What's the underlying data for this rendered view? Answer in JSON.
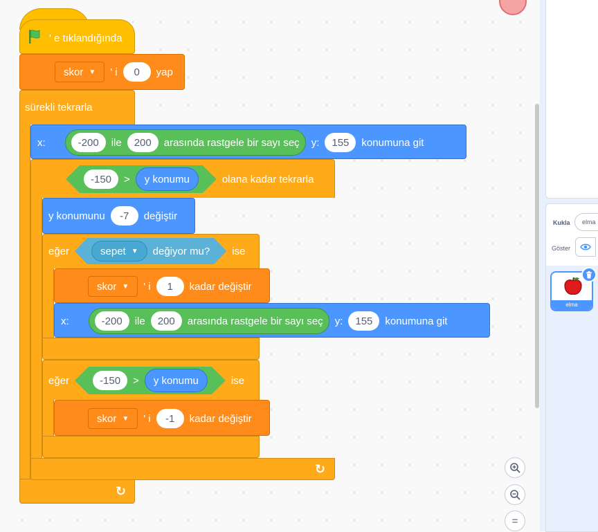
{
  "script": {
    "hat": {
      "label": "' e tıklandığında"
    },
    "set_var": {
      "variable": "skor",
      "suffix": "' i",
      "value": "0",
      "action": "yap"
    },
    "forever": {
      "label": "sürekli tekrarla"
    },
    "goto1": {
      "x_label": "x:",
      "rand_from": "-200",
      "rand_mid": "ile",
      "rand_to": "200",
      "rand_label": "arasında rastgele bir sayı seç",
      "y_label": "y:",
      "y_value": "155",
      "action": "konumuna git"
    },
    "repeat_until": {
      "left": "-150",
      "op": ">",
      "reporter": "y konumu",
      "label": "olana kadar tekrarla"
    },
    "change_y": {
      "label": "y konumunu",
      "value": "-7",
      "action": "değiştir"
    },
    "if1": {
      "if_label": "eğer",
      "sprite": "sepet",
      "touching": "değiyor mu?",
      "then": "ise"
    },
    "change_var1": {
      "variable": "skor",
      "suffix": "' i",
      "value": "1",
      "action": "kadar değiştir"
    },
    "goto2": {
      "x_label": "x:",
      "rand_from": "-200",
      "rand_mid": "ile",
      "rand_to": "200",
      "rand_label": "arasında rastgele bir sayı seç",
      "y_label": "y:",
      "y_value": "155",
      "action": "konumuna git"
    },
    "if2": {
      "if_label": "eğer",
      "left": "-150",
      "op": ">",
      "reporter": "y konumu",
      "then": "ise"
    },
    "change_var2": {
      "variable": "skor",
      "suffix": "' i",
      "value": "-1",
      "action": "kadar değiştir"
    }
  },
  "zoom": {
    "in_icon": "zoom-in-icon",
    "out_icon": "zoom-out-icon",
    "reset_icon": "zoom-reset-icon",
    "reset_symbol": "="
  },
  "sprite_panel": {
    "sprite_label": "Kukla",
    "sprite_name": "elma",
    "show_label": "Göster",
    "tiles": [
      {
        "name": "elma"
      }
    ]
  },
  "colors": {
    "events": "#ffbf00",
    "variables": "#ff8c1a",
    "control": "#ffab19",
    "motion": "#4c97ff",
    "operators": "#59c059",
    "sensing": "#5cb1d6"
  }
}
